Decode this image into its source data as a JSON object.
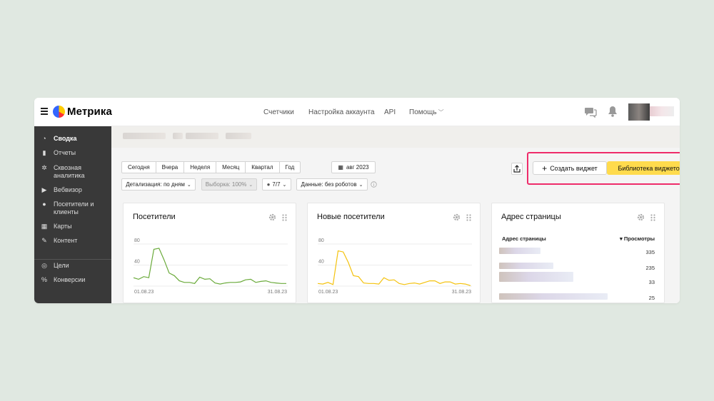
{
  "app": {
    "name": "Метрика"
  },
  "topnav": [
    {
      "label": "Счетчики"
    },
    {
      "label": "Настройка аккаунта"
    },
    {
      "label": "API"
    },
    {
      "label": "Помощь"
    }
  ],
  "sidebar": {
    "items": [
      {
        "label": "Сводка",
        "icon": "gauge-icon"
      },
      {
        "label": "Отчеты",
        "icon": "bar-chart-icon"
      },
      {
        "label": "Сквозная аналитика",
        "icon": "gear-flower-icon"
      },
      {
        "label": "Вебвизор",
        "icon": "play-icon"
      },
      {
        "label": "Посетители и клиенты",
        "icon": "person-icon"
      },
      {
        "label": "Карты",
        "icon": "map-icon"
      },
      {
        "label": "Контент",
        "icon": "pen-icon"
      },
      {
        "label": "Цели",
        "icon": "target-icon"
      },
      {
        "label": "Конверсии",
        "icon": "percent-icon"
      }
    ]
  },
  "toolbar": {
    "periods": [
      "Сегодня",
      "Вчера",
      "Неделя",
      "Месяц",
      "Квартал",
      "Год"
    ],
    "date_label": "авг 2023",
    "detail_label": "Детализация: по дням",
    "sample_label": "Выборка: 100%",
    "comment_label": "7/7",
    "data_label": "Данные: без роботов",
    "create_widget_label": "Создать виджет",
    "library_label": "Библиотека виджетов"
  },
  "colors": {
    "accent": "#ffdb4d",
    "highlight": "#ee2c6a",
    "visitors_line": "#6aaa3a",
    "new_visitors_line": "#f4c20d"
  },
  "widgets": {
    "visitors": {
      "title": "Посетители",
      "chart_data": {
        "type": "line",
        "x_start": "01.08.23",
        "x_end": "31.08.23",
        "yticks": [
          "80",
          "40"
        ],
        "ylim": [
          0,
          95
        ],
        "values": [
          16,
          13,
          18,
          16,
          70,
          72,
          50,
          25,
          20,
          10,
          7,
          7,
          5,
          17,
          13,
          14,
          6,
          4,
          6,
          7,
          7,
          8,
          12,
          13,
          7,
          9,
          10,
          7,
          6,
          5,
          5
        ]
      }
    },
    "new_visitors": {
      "title": "Новые посетители",
      "chart_data": {
        "type": "line",
        "x_start": "01.08.23",
        "x_end": "31.08.23",
        "yticks": [
          "80",
          "40"
        ],
        "ylim": [
          0,
          95
        ],
        "values": [
          5,
          4,
          7,
          3,
          67,
          65,
          45,
          20,
          18,
          6,
          5,
          5,
          4,
          16,
          11,
          12,
          5,
          3,
          5,
          6,
          4,
          7,
          10,
          10,
          5,
          8,
          8,
          4,
          5,
          4,
          1
        ]
      }
    },
    "pages": {
      "title": "Адрес страницы",
      "col_page": "Адрес страницы",
      "col_views": "▾ Просмотры",
      "rows": [
        {
          "views": "335"
        },
        {
          "views": "235"
        },
        {
          "views": "33"
        },
        {
          "views": "25"
        }
      ]
    }
  }
}
